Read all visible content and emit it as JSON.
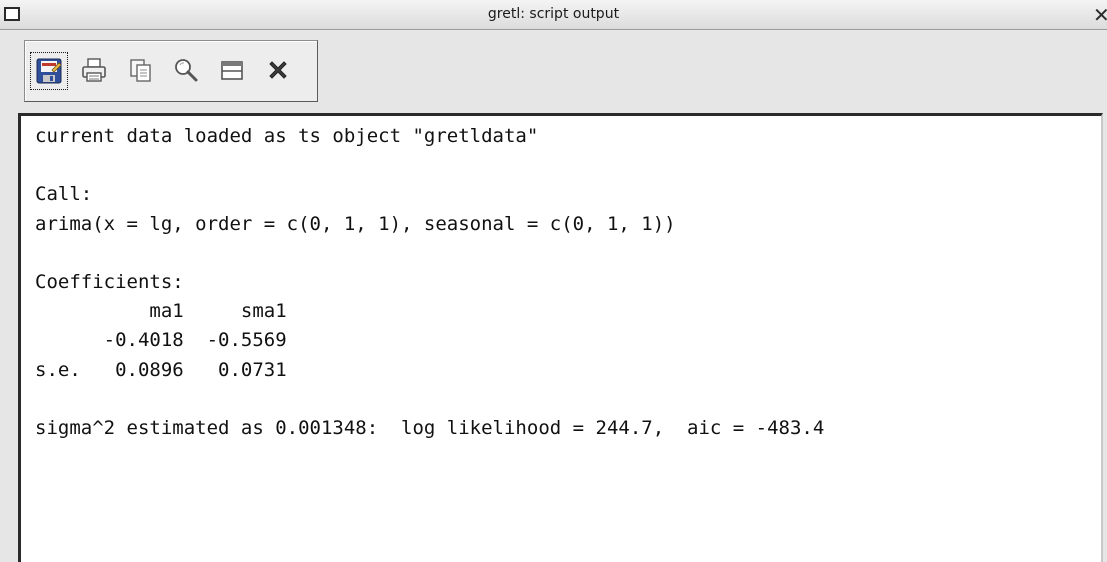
{
  "window": {
    "title": "gretl: script output",
    "close_glyph": "✕"
  },
  "toolbar": {
    "buttons": [
      {
        "name": "save-as-icon",
        "tooltip": "",
        "accent": "#c0392b"
      },
      {
        "name": "print-icon"
      },
      {
        "name": "copy-icon"
      },
      {
        "name": "find-icon"
      },
      {
        "name": "window-icon"
      },
      {
        "name": "close-icon"
      }
    ]
  },
  "output": {
    "lines": [
      "current data loaded as ts object \"gretldata\"",
      "",
      "Call:",
      "arima(x = lg, order = c(0, 1, 1), seasonal = c(0, 1, 1))",
      "",
      "Coefficients:",
      "          ma1     sma1",
      "      -0.4018  -0.5569",
      "s.e.   0.0896   0.0731",
      "",
      "sigma^2 estimated as 0.001348:  log likelihood = 244.7,  aic = -483.4"
    ]
  },
  "colors": {
    "window_bg": "#e6e6e6",
    "text_bg": "#ffffff",
    "text_fg": "#111111"
  }
}
